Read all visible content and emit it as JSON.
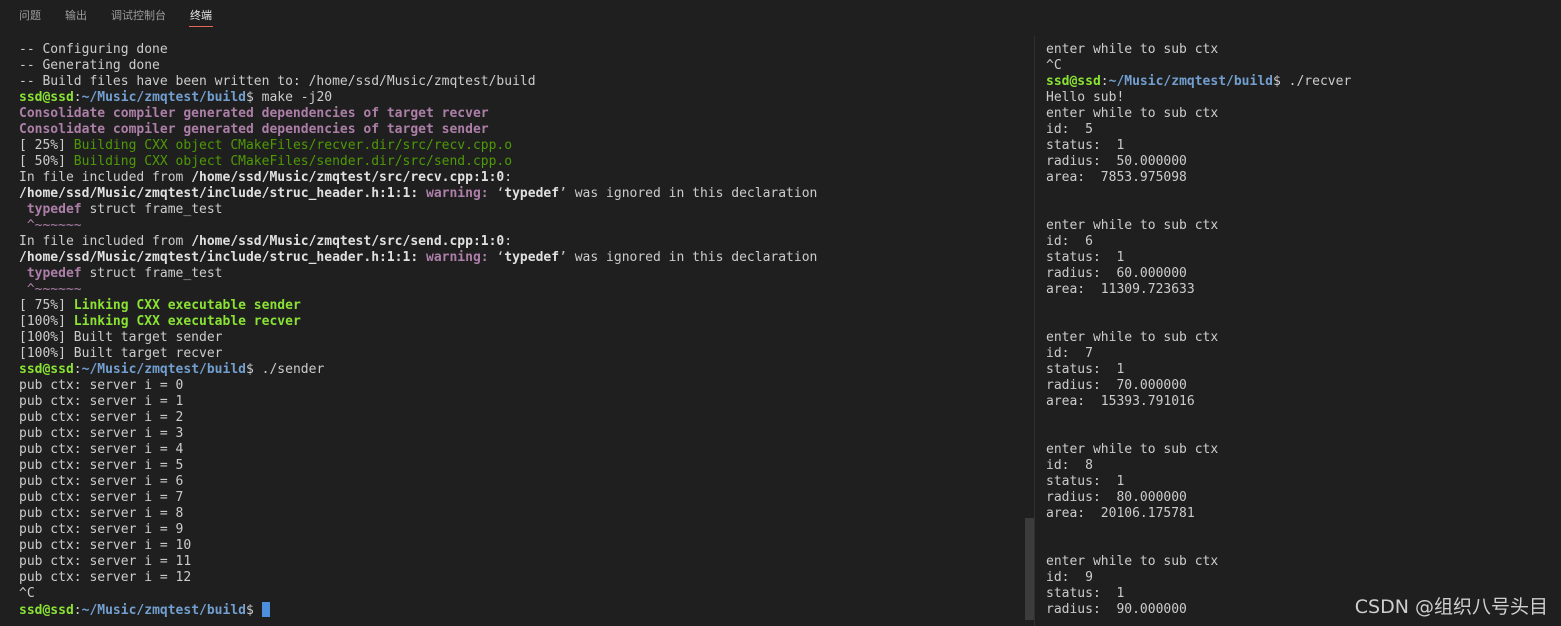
{
  "tabs": [
    {
      "label": "问题",
      "active": false
    },
    {
      "label": "输出",
      "active": false
    },
    {
      "label": "调试控制台",
      "active": false
    },
    {
      "label": "终端",
      "active": true
    }
  ],
  "left_terminal": {
    "lines": [
      [
        {
          "t": "-- Configuring done"
        }
      ],
      [
        {
          "t": "-- Generating done"
        }
      ],
      [
        {
          "t": "-- Build files have been written to: /home/ssd/Music/zmqtest/build"
        }
      ],
      [
        {
          "t": "ssd@ssd",
          "c": "pu"
        },
        {
          "t": ":"
        },
        {
          "t": "~/Music/zmqtest/build",
          "c": "path"
        },
        {
          "t": "$ make -j20"
        }
      ],
      [
        {
          "t": "Consolidate compiler generated dependencies of target recver",
          "c": "bpurple"
        }
      ],
      [
        {
          "t": "Consolidate compiler generated dependencies of target sender",
          "c": "bpurple"
        }
      ],
      [
        {
          "t": "[ 25%] "
        },
        {
          "t": "Building CXX object CMakeFiles/recver.dir/src/recv.cpp.o",
          "c": "green"
        }
      ],
      [
        {
          "t": "[ 50%] "
        },
        {
          "t": "Building CXX object CMakeFiles/sender.dir/src/send.cpp.o",
          "c": "green"
        }
      ],
      [
        {
          "t": "In file included from "
        },
        {
          "t": "/home/ssd/Music/zmqtest/src/recv.cpp:1:0",
          "c": "bold"
        },
        {
          "t": ":"
        }
      ],
      [
        {
          "t": "/home/ssd/Music/zmqtest/include/struc_header.h:1:1:",
          "c": "bold"
        },
        {
          "t": " "
        },
        {
          "t": "warning:",
          "c": "bpurple"
        },
        {
          "t": " ‘"
        },
        {
          "t": "typedef",
          "c": "bold"
        },
        {
          "t": "’ was ignored in this declaration"
        }
      ],
      [
        {
          "t": " "
        },
        {
          "t": "typedef",
          "c": "bpurple"
        },
        {
          "t": " struct frame_test"
        }
      ],
      [
        {
          "t": " ^~~~~~~",
          "c": "purple"
        }
      ],
      [
        {
          "t": "In file included from "
        },
        {
          "t": "/home/ssd/Music/zmqtest/src/send.cpp:1:0",
          "c": "bold"
        },
        {
          "t": ":"
        }
      ],
      [
        {
          "t": "/home/ssd/Music/zmqtest/include/struc_header.h:1:1:",
          "c": "bold"
        },
        {
          "t": " "
        },
        {
          "t": "warning:",
          "c": "bpurple"
        },
        {
          "t": " ‘"
        },
        {
          "t": "typedef",
          "c": "bold"
        },
        {
          "t": "’ was ignored in this declaration"
        }
      ],
      [
        {
          "t": " "
        },
        {
          "t": "typedef",
          "c": "bpurple"
        },
        {
          "t": " struct frame_test"
        }
      ],
      [
        {
          "t": " ^~~~~~~",
          "c": "purple"
        }
      ],
      [
        {
          "t": "[ 75%] "
        },
        {
          "t": "Linking CXX executable sender",
          "c": "bgreen"
        }
      ],
      [
        {
          "t": "[100%] "
        },
        {
          "t": "Linking CXX executable recver",
          "c": "bgreen"
        }
      ],
      [
        {
          "t": "[100%] Built target sender"
        }
      ],
      [
        {
          "t": "[100%] Built target recver"
        }
      ],
      [
        {
          "t": "ssd@ssd",
          "c": "pu"
        },
        {
          "t": ":"
        },
        {
          "t": "~/Music/zmqtest/build",
          "c": "path"
        },
        {
          "t": "$ ./sender"
        }
      ],
      [
        {
          "t": "pub ctx: server i = 0"
        }
      ],
      [
        {
          "t": "pub ctx: server i = 1"
        }
      ],
      [
        {
          "t": "pub ctx: server i = 2"
        }
      ],
      [
        {
          "t": "pub ctx: server i = 3"
        }
      ],
      [
        {
          "t": "pub ctx: server i = 4"
        }
      ],
      [
        {
          "t": "pub ctx: server i = 5"
        }
      ],
      [
        {
          "t": "pub ctx: server i = 6"
        }
      ],
      [
        {
          "t": "pub ctx: server i = 7"
        }
      ],
      [
        {
          "t": "pub ctx: server i = 8"
        }
      ],
      [
        {
          "t": "pub ctx: server i = 9"
        }
      ],
      [
        {
          "t": "pub ctx: server i = 10"
        }
      ],
      [
        {
          "t": "pub ctx: server i = 11"
        }
      ],
      [
        {
          "t": "pub ctx: server i = 12"
        }
      ],
      [
        {
          "t": "^C"
        }
      ],
      [
        {
          "t": "ssd@ssd",
          "c": "pu"
        },
        {
          "t": ":"
        },
        {
          "t": "~/Music/zmqtest/build",
          "c": "path"
        },
        {
          "t": "$ "
        },
        {
          "cursor": true
        }
      ]
    ]
  },
  "right_terminal": {
    "lines": [
      [
        {
          "t": "enter while to sub ctx"
        }
      ],
      [
        {
          "t": "^C"
        }
      ],
      [
        {
          "t": "ssd@ssd",
          "c": "pu"
        },
        {
          "t": ":"
        },
        {
          "t": "~/Music/zmqtest/build",
          "c": "path"
        },
        {
          "t": "$ ./recver"
        }
      ],
      [
        {
          "t": "Hello sub!"
        }
      ],
      [
        {
          "t": "enter while to sub ctx"
        }
      ],
      [
        {
          "t": "id:  5"
        }
      ],
      [
        {
          "t": "status:  1"
        }
      ],
      [
        {
          "t": "radius:  50.000000"
        }
      ],
      [
        {
          "t": "area:  7853.975098"
        }
      ],
      [
        {
          "t": ""
        }
      ],
      [
        {
          "t": ""
        }
      ],
      [
        {
          "t": "enter while to sub ctx"
        }
      ],
      [
        {
          "t": "id:  6"
        }
      ],
      [
        {
          "t": "status:  1"
        }
      ],
      [
        {
          "t": "radius:  60.000000"
        }
      ],
      [
        {
          "t": "area:  11309.723633"
        }
      ],
      [
        {
          "t": ""
        }
      ],
      [
        {
          "t": ""
        }
      ],
      [
        {
          "t": "enter while to sub ctx"
        }
      ],
      [
        {
          "t": "id:  7"
        }
      ],
      [
        {
          "t": "status:  1"
        }
      ],
      [
        {
          "t": "radius:  70.000000"
        }
      ],
      [
        {
          "t": "area:  15393.791016"
        }
      ],
      [
        {
          "t": ""
        }
      ],
      [
        {
          "t": ""
        }
      ],
      [
        {
          "t": "enter while to sub ctx"
        }
      ],
      [
        {
          "t": "id:  8"
        }
      ],
      [
        {
          "t": "status:  1"
        }
      ],
      [
        {
          "t": "radius:  80.000000"
        }
      ],
      [
        {
          "t": "area:  20106.175781"
        }
      ],
      [
        {
          "t": ""
        }
      ],
      [
        {
          "t": ""
        }
      ],
      [
        {
          "t": "enter while to sub ctx"
        }
      ],
      [
        {
          "t": "id:  9"
        }
      ],
      [
        {
          "t": "status:  1"
        }
      ],
      [
        {
          "t": "radius:  90.000000"
        }
      ]
    ]
  },
  "watermark": "CSDN @组织八号头目"
}
